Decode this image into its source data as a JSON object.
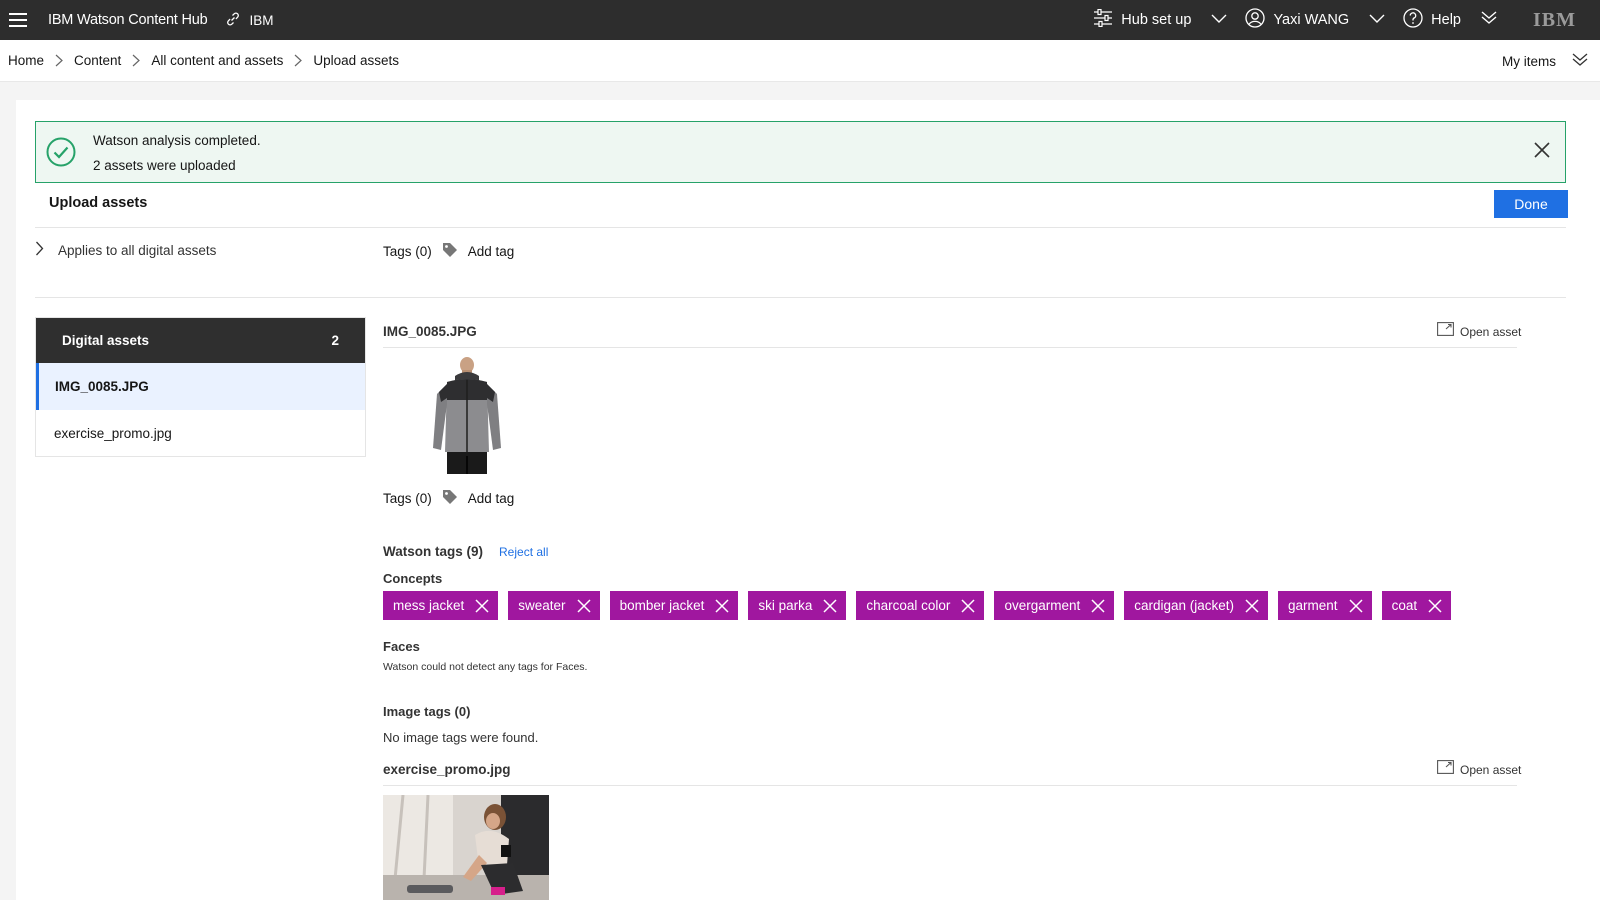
{
  "topbar": {
    "brand": "IBM Watson Content Hub",
    "org": "IBM",
    "hub_setup": "Hub set up",
    "user": "Yaxi WANG",
    "help": "Help",
    "logo": "IBM"
  },
  "breadcrumb": {
    "items": [
      "Home",
      "Content",
      "All content and assets",
      "Upload assets"
    ],
    "my_items": "My items"
  },
  "notification": {
    "title": "Watson analysis completed.",
    "subtitle": "2 assets were uploaded"
  },
  "upload": {
    "title": "Upload assets",
    "done_label": "Done",
    "applies_label": "Applies to all digital assets",
    "global_tags_label": "Tags (0)",
    "add_tag_label": "Add tag"
  },
  "assets_panel": {
    "header": "Digital assets",
    "count": "2",
    "items": [
      "IMG_0085.JPG",
      "exercise_promo.jpg"
    ]
  },
  "asset1": {
    "name": "IMG_0085.JPG",
    "open_label": "Open asset",
    "tags_label": "Tags (0)",
    "add_tag_label": "Add tag",
    "watson_tags_label": "Watson tags (9)",
    "reject_all_label": "Reject all",
    "concepts_label": "Concepts",
    "concepts": [
      "mess jacket",
      "sweater",
      "bomber jacket",
      "ski parka",
      "charcoal color",
      "overgarment",
      "cardigan (jacket)",
      "garment",
      "coat"
    ],
    "faces_label": "Faces",
    "faces_text": "Watson could not detect any tags for Faces.",
    "image_tags_label": "Image tags (0)",
    "image_tags_text": "No image tags were found."
  },
  "asset2": {
    "name": "exercise_promo.jpg",
    "open_label": "Open asset"
  },
  "colors": {
    "topbar_bg": "#2d2d2d",
    "accent_blue": "#1f70e3",
    "chip_purple": "#a0179f",
    "success_green": "#26a269"
  }
}
